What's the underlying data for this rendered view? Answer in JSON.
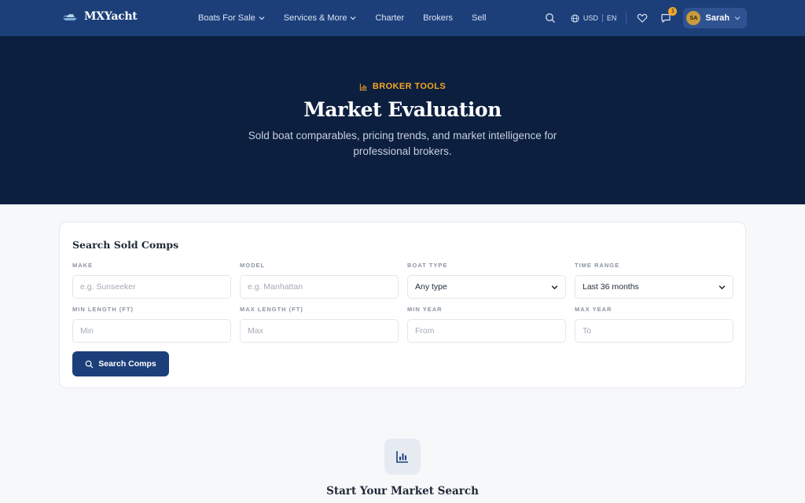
{
  "brand": {
    "name": "MXYacht",
    "logo_icon": "yacht-icon"
  },
  "nav": {
    "items": [
      {
        "label": "Boats For Sale",
        "has_dropdown": true
      },
      {
        "label": "Services & More",
        "has_dropdown": true
      },
      {
        "label": "Charter",
        "has_dropdown": false
      },
      {
        "label": "Brokers",
        "has_dropdown": false
      },
      {
        "label": "Sell",
        "has_dropdown": false
      }
    ],
    "currency": "USD",
    "language": "EN",
    "messages_count": "1",
    "user": {
      "initials": "SA",
      "name": "Sarah"
    }
  },
  "hero": {
    "eyebrow": "BROKER TOOLS",
    "title": "Market Evaluation",
    "subtitle": "Sold boat comparables, pricing trends, and market intelligence for professional brokers."
  },
  "search": {
    "title": "Search Sold Comps",
    "fields": {
      "make": {
        "label": "MAKE",
        "placeholder": "e.g. Sunseeker",
        "value": ""
      },
      "model": {
        "label": "MODEL",
        "placeholder": "e.g. Manhattan",
        "value": ""
      },
      "boat_type": {
        "label": "BOAT TYPE",
        "selected": "Any type"
      },
      "time_range": {
        "label": "TIME RANGE",
        "selected": "Last 36 months"
      },
      "min_length": {
        "label": "MIN LENGTH (FT)",
        "placeholder": "Min",
        "value": ""
      },
      "max_length": {
        "label": "MAX LENGTH (FT)",
        "placeholder": "Max",
        "value": ""
      },
      "min_year": {
        "label": "MIN YEAR",
        "placeholder": "From",
        "value": ""
      },
      "max_year": {
        "label": "MAX YEAR",
        "placeholder": "To",
        "value": ""
      }
    },
    "button_label": "Search Comps"
  },
  "empty_state": {
    "title": "Start Your Market Search",
    "icon": "bar-chart-icon"
  },
  "colors": {
    "nav_bg": "#1c3f7a",
    "hero_bg": "#0c1f3f",
    "accent": "#f5a623",
    "primary_button": "#1c3f7a",
    "page_bg": "#f7f8fa"
  }
}
